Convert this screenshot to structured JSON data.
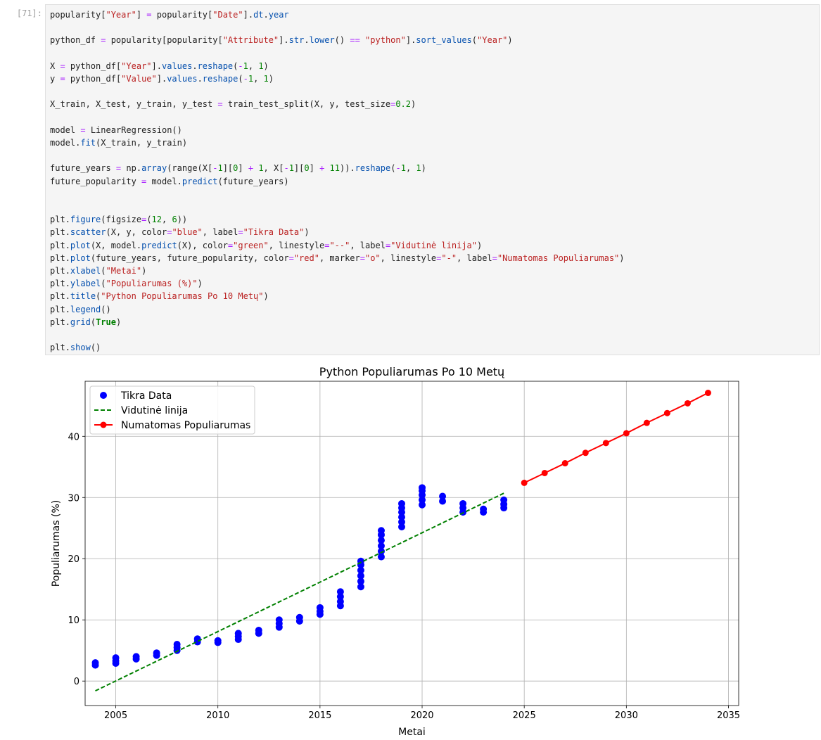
{
  "cell": {
    "prompt": "[71]:",
    "code_lines": [
      [
        {
          "t": "popularity",
          "k": "var"
        },
        {
          "t": "[",
          "k": "p"
        },
        {
          "t": "\"Year\"",
          "k": "str"
        },
        {
          "t": "] ",
          "k": "p"
        },
        {
          "t": "=",
          "k": "op"
        },
        {
          "t": " popularity",
          "k": "var"
        },
        {
          "t": "[",
          "k": "p"
        },
        {
          "t": "\"Date\"",
          "k": "str"
        },
        {
          "t": "].",
          "k": "p"
        },
        {
          "t": "dt",
          "k": "attr"
        },
        {
          "t": ".",
          "k": "p"
        },
        {
          "t": "year",
          "k": "attr"
        }
      ],
      [],
      [
        {
          "t": "python_df ",
          "k": "var"
        },
        {
          "t": "=",
          "k": "op"
        },
        {
          "t": " popularity",
          "k": "var"
        },
        {
          "t": "[",
          "k": "p"
        },
        {
          "t": "popularity",
          "k": "var"
        },
        {
          "t": "[",
          "k": "p"
        },
        {
          "t": "\"Attribute\"",
          "k": "str"
        },
        {
          "t": "].",
          "k": "p"
        },
        {
          "t": "str",
          "k": "attr"
        },
        {
          "t": ".",
          "k": "p"
        },
        {
          "t": "lower",
          "k": "attr"
        },
        {
          "t": "() ",
          "k": "p"
        },
        {
          "t": "==",
          "k": "op"
        },
        {
          "t": " ",
          "k": "p"
        },
        {
          "t": "\"python\"",
          "k": "str"
        },
        {
          "t": "].",
          "k": "p"
        },
        {
          "t": "sort_values",
          "k": "attr"
        },
        {
          "t": "(",
          "k": "p"
        },
        {
          "t": "\"Year\"",
          "k": "str"
        },
        {
          "t": ")",
          "k": "p"
        }
      ],
      [],
      [
        {
          "t": "X ",
          "k": "var"
        },
        {
          "t": "=",
          "k": "op"
        },
        {
          "t": " python_df",
          "k": "var"
        },
        {
          "t": "[",
          "k": "p"
        },
        {
          "t": "\"Year\"",
          "k": "str"
        },
        {
          "t": "].",
          "k": "p"
        },
        {
          "t": "values",
          "k": "attr"
        },
        {
          "t": ".",
          "k": "p"
        },
        {
          "t": "reshape",
          "k": "attr"
        },
        {
          "t": "(",
          "k": "p"
        },
        {
          "t": "-",
          "k": "op"
        },
        {
          "t": "1",
          "k": "num"
        },
        {
          "t": ", ",
          "k": "p"
        },
        {
          "t": "1",
          "k": "num"
        },
        {
          "t": ")",
          "k": "p"
        }
      ],
      [
        {
          "t": "y ",
          "k": "var"
        },
        {
          "t": "=",
          "k": "op"
        },
        {
          "t": " python_df",
          "k": "var"
        },
        {
          "t": "[",
          "k": "p"
        },
        {
          "t": "\"Value\"",
          "k": "str"
        },
        {
          "t": "].",
          "k": "p"
        },
        {
          "t": "values",
          "k": "attr"
        },
        {
          "t": ".",
          "k": "p"
        },
        {
          "t": "reshape",
          "k": "attr"
        },
        {
          "t": "(",
          "k": "p"
        },
        {
          "t": "-",
          "k": "op"
        },
        {
          "t": "1",
          "k": "num"
        },
        {
          "t": ", ",
          "k": "p"
        },
        {
          "t": "1",
          "k": "num"
        },
        {
          "t": ")",
          "k": "p"
        }
      ],
      [],
      [
        {
          "t": "X_train, X_test, y_train, y_test ",
          "k": "var"
        },
        {
          "t": "=",
          "k": "op"
        },
        {
          "t": " train_test_split(X, y, test_size",
          "k": "var"
        },
        {
          "t": "=",
          "k": "op"
        },
        {
          "t": "0.2",
          "k": "num"
        },
        {
          "t": ")",
          "k": "p"
        }
      ],
      [],
      [
        {
          "t": "model ",
          "k": "var"
        },
        {
          "t": "=",
          "k": "op"
        },
        {
          "t": " LinearRegression()",
          "k": "var"
        }
      ],
      [
        {
          "t": "model",
          "k": "var"
        },
        {
          "t": ".",
          "k": "p"
        },
        {
          "t": "fit",
          "k": "attr"
        },
        {
          "t": "(X_train, y_train)",
          "k": "p"
        }
      ],
      [],
      [
        {
          "t": "future_years ",
          "k": "var"
        },
        {
          "t": "=",
          "k": "op"
        },
        {
          "t": " np",
          "k": "var"
        },
        {
          "t": ".",
          "k": "p"
        },
        {
          "t": "array",
          "k": "attr"
        },
        {
          "t": "(range(X[",
          "k": "p"
        },
        {
          "t": "-",
          "k": "op"
        },
        {
          "t": "1",
          "k": "num"
        },
        {
          "t": "][",
          "k": "p"
        },
        {
          "t": "0",
          "k": "num"
        },
        {
          "t": "] ",
          "k": "p"
        },
        {
          "t": "+",
          "k": "op"
        },
        {
          "t": " ",
          "k": "p"
        },
        {
          "t": "1",
          "k": "num"
        },
        {
          "t": ", X[",
          "k": "p"
        },
        {
          "t": "-",
          "k": "op"
        },
        {
          "t": "1",
          "k": "num"
        },
        {
          "t": "][",
          "k": "p"
        },
        {
          "t": "0",
          "k": "num"
        },
        {
          "t": "] ",
          "k": "p"
        },
        {
          "t": "+",
          "k": "op"
        },
        {
          "t": " ",
          "k": "p"
        },
        {
          "t": "11",
          "k": "num"
        },
        {
          "t": ")).",
          "k": "p"
        },
        {
          "t": "reshape",
          "k": "attr"
        },
        {
          "t": "(",
          "k": "p"
        },
        {
          "t": "-",
          "k": "op"
        },
        {
          "t": "1",
          "k": "num"
        },
        {
          "t": ", ",
          "k": "p"
        },
        {
          "t": "1",
          "k": "num"
        },
        {
          "t": ")",
          "k": "p"
        }
      ],
      [
        {
          "t": "future_popularity ",
          "k": "var"
        },
        {
          "t": "=",
          "k": "op"
        },
        {
          "t": " model",
          "k": "var"
        },
        {
          "t": ".",
          "k": "p"
        },
        {
          "t": "predict",
          "k": "attr"
        },
        {
          "t": "(future_years)",
          "k": "p"
        }
      ],
      [],
      [],
      [
        {
          "t": "plt",
          "k": "var"
        },
        {
          "t": ".",
          "k": "p"
        },
        {
          "t": "figure",
          "k": "attr"
        },
        {
          "t": "(figsize",
          "k": "p"
        },
        {
          "t": "=",
          "k": "op"
        },
        {
          "t": "(",
          "k": "p"
        },
        {
          "t": "12",
          "k": "num"
        },
        {
          "t": ", ",
          "k": "p"
        },
        {
          "t": "6",
          "k": "num"
        },
        {
          "t": "))",
          "k": "p"
        }
      ],
      [
        {
          "t": "plt",
          "k": "var"
        },
        {
          "t": ".",
          "k": "p"
        },
        {
          "t": "scatter",
          "k": "attr"
        },
        {
          "t": "(X, y, color",
          "k": "p"
        },
        {
          "t": "=",
          "k": "op"
        },
        {
          "t": "\"blue\"",
          "k": "str"
        },
        {
          "t": ", label",
          "k": "p"
        },
        {
          "t": "=",
          "k": "op"
        },
        {
          "t": "\"Tikra Data\"",
          "k": "str"
        },
        {
          "t": ")",
          "k": "p"
        }
      ],
      [
        {
          "t": "plt",
          "k": "var"
        },
        {
          "t": ".",
          "k": "p"
        },
        {
          "t": "plot",
          "k": "attr"
        },
        {
          "t": "(X, model",
          "k": "p"
        },
        {
          "t": ".",
          "k": "p"
        },
        {
          "t": "predict",
          "k": "attr"
        },
        {
          "t": "(X), color",
          "k": "p"
        },
        {
          "t": "=",
          "k": "op"
        },
        {
          "t": "\"green\"",
          "k": "str"
        },
        {
          "t": ", linestyle",
          "k": "p"
        },
        {
          "t": "=",
          "k": "op"
        },
        {
          "t": "\"--\"",
          "k": "str"
        },
        {
          "t": ", label",
          "k": "p"
        },
        {
          "t": "=",
          "k": "op"
        },
        {
          "t": "\"Vidutinė linija\"",
          "k": "str"
        },
        {
          "t": ")",
          "k": "p"
        }
      ],
      [
        {
          "t": "plt",
          "k": "var"
        },
        {
          "t": ".",
          "k": "p"
        },
        {
          "t": "plot",
          "k": "attr"
        },
        {
          "t": "(future_years, future_popularity, color",
          "k": "p"
        },
        {
          "t": "=",
          "k": "op"
        },
        {
          "t": "\"red\"",
          "k": "str"
        },
        {
          "t": ", marker",
          "k": "p"
        },
        {
          "t": "=",
          "k": "op"
        },
        {
          "t": "\"o\"",
          "k": "str"
        },
        {
          "t": ", linestyle",
          "k": "p"
        },
        {
          "t": "=",
          "k": "op"
        },
        {
          "t": "\"-\"",
          "k": "str"
        },
        {
          "t": ", label",
          "k": "p"
        },
        {
          "t": "=",
          "k": "op"
        },
        {
          "t": "\"Numatomas Populiarumas\"",
          "k": "str"
        },
        {
          "t": ")",
          "k": "p"
        }
      ],
      [
        {
          "t": "plt",
          "k": "var"
        },
        {
          "t": ".",
          "k": "p"
        },
        {
          "t": "xlabel",
          "k": "attr"
        },
        {
          "t": "(",
          "k": "p"
        },
        {
          "t": "\"Metai\"",
          "k": "str"
        },
        {
          "t": ")",
          "k": "p"
        }
      ],
      [
        {
          "t": "plt",
          "k": "var"
        },
        {
          "t": ".",
          "k": "p"
        },
        {
          "t": "ylabel",
          "k": "attr"
        },
        {
          "t": "(",
          "k": "p"
        },
        {
          "t": "\"Populiarumas (%)\"",
          "k": "str"
        },
        {
          "t": ")",
          "k": "p"
        }
      ],
      [
        {
          "t": "plt",
          "k": "var"
        },
        {
          "t": ".",
          "k": "p"
        },
        {
          "t": "title",
          "k": "attr"
        },
        {
          "t": "(",
          "k": "p"
        },
        {
          "t": "\"Python Populiarumas Po 10 Metų\"",
          "k": "str"
        },
        {
          "t": ")",
          "k": "p"
        }
      ],
      [
        {
          "t": "plt",
          "k": "var"
        },
        {
          "t": ".",
          "k": "p"
        },
        {
          "t": "legend",
          "k": "attr"
        },
        {
          "t": "()",
          "k": "p"
        }
      ],
      [
        {
          "t": "plt",
          "k": "var"
        },
        {
          "t": ".",
          "k": "p"
        },
        {
          "t": "grid",
          "k": "attr"
        },
        {
          "t": "(",
          "k": "p"
        },
        {
          "t": "True",
          "k": "kw"
        },
        {
          "t": ")",
          "k": "p"
        }
      ],
      [],
      [
        {
          "t": "plt",
          "k": "var"
        },
        {
          "t": ".",
          "k": "p"
        },
        {
          "t": "show",
          "k": "attr"
        },
        {
          "t": "()",
          "k": "p"
        }
      ]
    ]
  },
  "chart_data": {
    "type": "scatter",
    "title": "Python Populiarumas Po 10 Metų",
    "xlabel": "Metai",
    "ylabel": "Populiarumas (%)",
    "xlim": [
      2003.5,
      2035.5
    ],
    "ylim": [
      -4,
      49
    ],
    "xticks": [
      2005,
      2010,
      2015,
      2020,
      2025,
      2030,
      2035
    ],
    "yticks": [
      0,
      10,
      20,
      30,
      40
    ],
    "grid": true,
    "legend_position": "top-left",
    "series": [
      {
        "name": "Tikra Data",
        "kind": "scatter",
        "color": "#0000ff",
        "points": [
          [
            2004,
            2.6
          ],
          [
            2004,
            3.0
          ],
          [
            2005,
            2.9
          ],
          [
            2005,
            3.3
          ],
          [
            2005,
            3.8
          ],
          [
            2006,
            3.6
          ],
          [
            2006,
            4.0
          ],
          [
            2007,
            4.2
          ],
          [
            2007,
            4.6
          ],
          [
            2008,
            5.0
          ],
          [
            2008,
            5.5
          ],
          [
            2008,
            6.0
          ],
          [
            2009,
            6.4
          ],
          [
            2009,
            6.9
          ],
          [
            2010,
            6.3
          ],
          [
            2010,
            6.6
          ],
          [
            2011,
            6.8
          ],
          [
            2011,
            7.3
          ],
          [
            2011,
            7.8
          ],
          [
            2012,
            7.8
          ],
          [
            2012,
            8.3
          ],
          [
            2013,
            8.8
          ],
          [
            2013,
            9.4
          ],
          [
            2013,
            10.0
          ],
          [
            2014,
            9.8
          ],
          [
            2014,
            10.4
          ],
          [
            2015,
            10.9
          ],
          [
            2015,
            11.4
          ],
          [
            2015,
            12.0
          ],
          [
            2016,
            12.3
          ],
          [
            2016,
            13.0
          ],
          [
            2016,
            13.8
          ],
          [
            2016,
            14.6
          ],
          [
            2017,
            15.4
          ],
          [
            2017,
            16.3
          ],
          [
            2017,
            17.2
          ],
          [
            2017,
            18.1
          ],
          [
            2017,
            19.0
          ],
          [
            2017,
            19.6
          ],
          [
            2018,
            20.3
          ],
          [
            2018,
            21.2
          ],
          [
            2018,
            22.1
          ],
          [
            2018,
            23.0
          ],
          [
            2018,
            23.9
          ],
          [
            2018,
            24.6
          ],
          [
            2019,
            25.2
          ],
          [
            2019,
            26.0
          ],
          [
            2019,
            26.8
          ],
          [
            2019,
            27.6
          ],
          [
            2019,
            28.3
          ],
          [
            2019,
            29.0
          ],
          [
            2020,
            28.8
          ],
          [
            2020,
            29.6
          ],
          [
            2020,
            30.4
          ],
          [
            2020,
            31.1
          ],
          [
            2020,
            31.6
          ],
          [
            2021,
            29.4
          ],
          [
            2021,
            30.2
          ],
          [
            2022,
            27.6
          ],
          [
            2022,
            28.3
          ],
          [
            2022,
            29.0
          ],
          [
            2023,
            27.6
          ],
          [
            2023,
            28.1
          ],
          [
            2024,
            28.3
          ],
          [
            2024,
            28.9
          ],
          [
            2024,
            29.6
          ]
        ]
      },
      {
        "name": "Vidutinė linija",
        "kind": "line",
        "color": "#008000",
        "linestyle": "dashed",
        "x": [
          2004,
          2024
        ],
        "y": [
          -1.6,
          30.7
        ]
      },
      {
        "name": "Numatomas Populiarumas",
        "kind": "line-marker",
        "color": "#ff0000",
        "x": [
          2025,
          2026,
          2027,
          2028,
          2029,
          2030,
          2031,
          2032,
          2033,
          2034
        ],
        "y": [
          32.4,
          34.0,
          35.6,
          37.3,
          38.9,
          40.5,
          42.2,
          43.8,
          45.4,
          47.1
        ]
      }
    ]
  }
}
